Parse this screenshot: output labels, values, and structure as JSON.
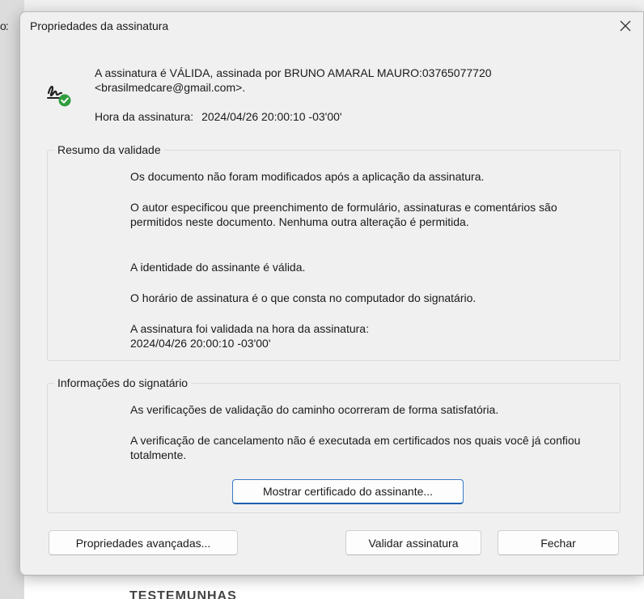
{
  "background": {
    "left_partial_text": "o:",
    "bottom_partial_text": "TESTEMUNHAS"
  },
  "dialog": {
    "title": "Propriedades da assinatura",
    "close_icon": "close-icon",
    "signature_icon": "signature-valid-icon",
    "status_text": "A assinatura é VÁLIDA, assinada por BRUNO AMARAL MAURO:03765077720 <brasilmedcare@gmail.com>.",
    "time_label": "Hora da assinatura:",
    "time_value": "2024/04/26 20:00:10 -03'00'"
  },
  "validity_summary": {
    "title": "Resumo da validade",
    "items": [
      "Os documento não foram modificados após a aplicação da assinatura.",
      "O autor especificou que preenchimento de formulário, assinaturas e comentários são permitidos neste documento. Nenhuma outra alteração é permitida.",
      "A identidade do assinante é válida.",
      "O horário de assinatura é o que consta no computador do signatário.",
      "A assinatura foi validada na hora da assinatura:",
      "2024/04/26 20:00:10 -03'00'"
    ]
  },
  "signer_info": {
    "title": "Informações do signatário",
    "items": [
      "As verificações de validação do caminho ocorreram de forma satisfatória.",
      "A verificação de cancelamento não é executada em certificados nos quais você já confiou totalmente."
    ],
    "show_cert_button": "Mostrar certificado do assinante..."
  },
  "footer": {
    "advanced_button": "Propriedades avançadas...",
    "validate_button": "Validar assinatura",
    "close_button": "Fechar"
  },
  "colors": {
    "accent": "#1d5fb0",
    "valid_check": "#2e9e3e",
    "dialog_bg": "#f0f0f0"
  }
}
